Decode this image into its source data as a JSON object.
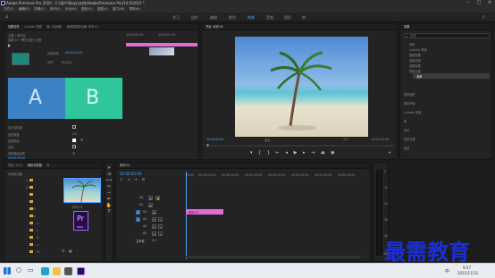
{
  "window": {
    "title": "Adobe Premiere Pro 2020 - C:\\用户\\Ebay\\文档\\Adobe\\Premiere Pro\\14.0\\2022 *"
  },
  "menu": [
    "文件(F)",
    "编辑(E)",
    "剪辑(C)",
    "序列(S)",
    "标记(M)",
    "图形(G)",
    "视图(V)",
    "窗口(W)",
    "帮助(H)"
  ],
  "workspaces": [
    "学习",
    "组件",
    "编辑",
    "颜色",
    "效果",
    "音频",
    "图形",
    "库"
  ],
  "active_workspace": "效果",
  "effect_controls": {
    "tabs": [
      "效果控件",
      "Lumetri 范围",
      "源: (无剪辑)",
      "音频剪辑混合器: 序列 01"
    ],
    "source_line": "主要 * 序列名",
    "clip_line": "剪辑 01 * 黑白过渡 / 过渡",
    "duration_label": "持续时间",
    "duration": "00:00:01:00",
    "align_label": "对齐:",
    "align_value": "中心切入",
    "timecode_left": "00:00:00:00",
    "timecode_right": "00:00:01:00",
    "clip_a": "A",
    "clip_b": "B",
    "settings": [
      {
        "label": "显示实际源",
        "type": "checkbox"
      },
      {
        "label": "边框宽度",
        "value": "0.0"
      },
      {
        "label": "边框颜色",
        "type": "swatch"
      },
      {
        "label": "反向",
        "type": "checkbox"
      },
      {
        "label": "消除锯齿品质",
        "value": "关"
      }
    ],
    "timecode_bottom": "00:00:00:00"
  },
  "program": {
    "tab": "节目: 序列 01",
    "timecode": "00:00:00:00",
    "fit": "适合",
    "fraction": "1/2",
    "duration": "00:00:05:00"
  },
  "effects": {
    "tab": "效果",
    "search_placeholder": "搜索",
    "tree": [
      "预设",
      "Lumetri 预设",
      "音频效果",
      "音频过渡",
      "视频效果",
      "视频过渡",
      "溶解"
    ],
    "right_list": [
      "基本图形",
      "基本声音",
      "Lumetri 颜色",
      "库",
      "标记",
      "历史记录",
      "信息"
    ]
  },
  "project": {
    "tabs": [
      "项目: 2022",
      "媒体浏览器",
      "库"
    ],
    "thumb_label": "序列 01",
    "pr_label": "Pr",
    "pr_sub": "PROJ",
    "bins": [
      "本地驱动器",
      "C:",
      "D:",
      "E:",
      "F:",
      "G:",
      "H:",
      "I:",
      "J:",
      "K:",
      "L:",
      "M:"
    ]
  },
  "timeline": {
    "tab": "序列 01",
    "timecode": "00:00:00:00",
    "ruler": [
      "00:00",
      "00:00:05:00",
      "00:00:10:00",
      "00:00:15:00",
      "00:00:20:00",
      "00:00:25:00",
      "00:00:30:00",
      "00:00:35:00"
    ],
    "tracks": [
      "V3",
      "V2",
      "V1",
      "A1",
      "A2",
      "A3",
      "主声道"
    ],
    "master_value": "0.0",
    "clip_label": "序列 01"
  },
  "audio_meter": {
    "labels": [
      "0",
      "-12",
      "-24",
      "-36",
      "-48",
      "dB"
    ]
  },
  "watermark": "最需教育",
  "taskbar": {
    "time": "9:57",
    "date": "2021/11/12",
    "lang": "中"
  },
  "colors": {
    "clip_a": "#3b82c4",
    "clip_b": "#2fc69c",
    "timeline_clip": "#e26bd6",
    "accent": "#4aa3ff",
    "watermark": "#1a2fd6"
  }
}
